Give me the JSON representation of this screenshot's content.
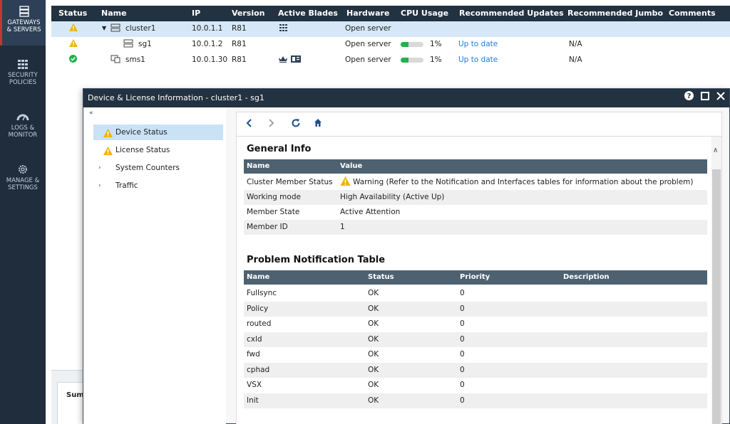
{
  "nav": {
    "items": [
      {
        "label1": "GATEWAYS",
        "label2": "& SERVERS",
        "icon": "server-icon"
      },
      {
        "label1": "SECURITY",
        "label2": "POLICIES",
        "icon": "grid-icon"
      },
      {
        "label1": "LOGS &",
        "label2": "MONITOR",
        "icon": "gauge-icon"
      },
      {
        "label1": "MANAGE &",
        "label2": "SETTINGS",
        "icon": "gear-icon"
      }
    ]
  },
  "grid": {
    "columns": [
      "Status",
      "Name",
      "IP",
      "Version",
      "Active Blades",
      "Hardware",
      "CPU Usage",
      "Recommended Updates",
      "Recommended Jumbo",
      "Comments"
    ],
    "rows": [
      {
        "name": "cluster1",
        "ip": "10.0.1.1",
        "version": "R81",
        "hardware": "Open server",
        "cpu": "",
        "updates": "",
        "jumbo": ""
      },
      {
        "name": "sg1",
        "ip": "10.0.1.2",
        "version": "R81",
        "hardware": "Open server",
        "cpu": "1%",
        "cpu_fraction": 0.35,
        "updates": "Up to date",
        "jumbo": "N/A"
      },
      {
        "name": "sms1",
        "ip": "10.0.1.30",
        "version": "R81",
        "hardware": "Open server",
        "cpu": "1%",
        "cpu_fraction": 0.35,
        "updates": "Up to date",
        "jumbo": "N/A"
      }
    ]
  },
  "bottom": {
    "tab": "Sum"
  },
  "dialog": {
    "title": "Device & License Information - cluster1 - sg1",
    "collapse": "«",
    "side": [
      "Device Status",
      "License Status",
      "System Counters",
      "Traffic"
    ],
    "general": {
      "heading": "General Info",
      "col_name": "Name",
      "col_value": "Value",
      "rows": [
        {
          "name": "Cluster Member Status",
          "value": "Warning (Refer to the Notification and Interfaces tables for information about the problem)"
        },
        {
          "name": "Working mode",
          "value": "High Availability (Active Up)"
        },
        {
          "name": "Member State",
          "value": "Active Attention"
        },
        {
          "name": "Member ID",
          "value": "1"
        }
      ]
    },
    "problems": {
      "heading": "Problem Notification Table",
      "columns": [
        "Name",
        "Status",
        "Priority",
        "Description"
      ],
      "rows": [
        {
          "name": "Fullsync",
          "status": "OK",
          "priority": "0"
        },
        {
          "name": "Policy",
          "status": "OK",
          "priority": "0"
        },
        {
          "name": "routed",
          "status": "OK",
          "priority": "0"
        },
        {
          "name": "cxld",
          "status": "OK",
          "priority": "0"
        },
        {
          "name": "fwd",
          "status": "OK",
          "priority": "0"
        },
        {
          "name": "cphad",
          "status": "OK",
          "priority": "0"
        },
        {
          "name": "VSX",
          "status": "OK",
          "priority": "0"
        },
        {
          "name": "Init",
          "status": "OK",
          "priority": "0"
        }
      ]
    }
  },
  "colors": {
    "nav_bg": "#1f2d3d",
    "header_bg": "#233240",
    "warning": "#f0b400",
    "ok": "#22b14c",
    "link": "#2a7bd0",
    "selected": "#c9e2f6"
  }
}
